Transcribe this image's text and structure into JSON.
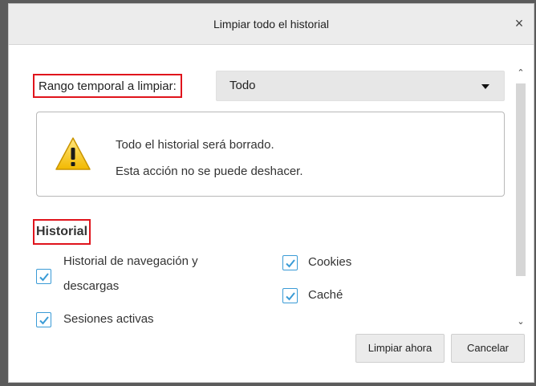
{
  "dialog": {
    "title": "Limpiar todo el historial",
    "close_icon": "×"
  },
  "range": {
    "label": "Rango temporal a limpiar:",
    "selected": "Todo"
  },
  "warning": {
    "line1": "Todo el historial será borrado.",
    "line2": "Esta acción no se puede deshacer."
  },
  "history": {
    "heading": "Historial",
    "items": [
      {
        "label_line1": "Historial de navegación y",
        "label_line2": "descargas",
        "checked": true
      },
      {
        "label": "Cookies",
        "checked": true
      },
      {
        "label": "Caché",
        "checked": true
      },
      {
        "label": "Sesiones activas",
        "checked": true
      }
    ]
  },
  "buttons": {
    "clear_now": "Limpiar ahora",
    "cancel": "Cancelar"
  },
  "colors": {
    "highlight": "#e0141c",
    "checkbox": "#3a9bd6"
  }
}
